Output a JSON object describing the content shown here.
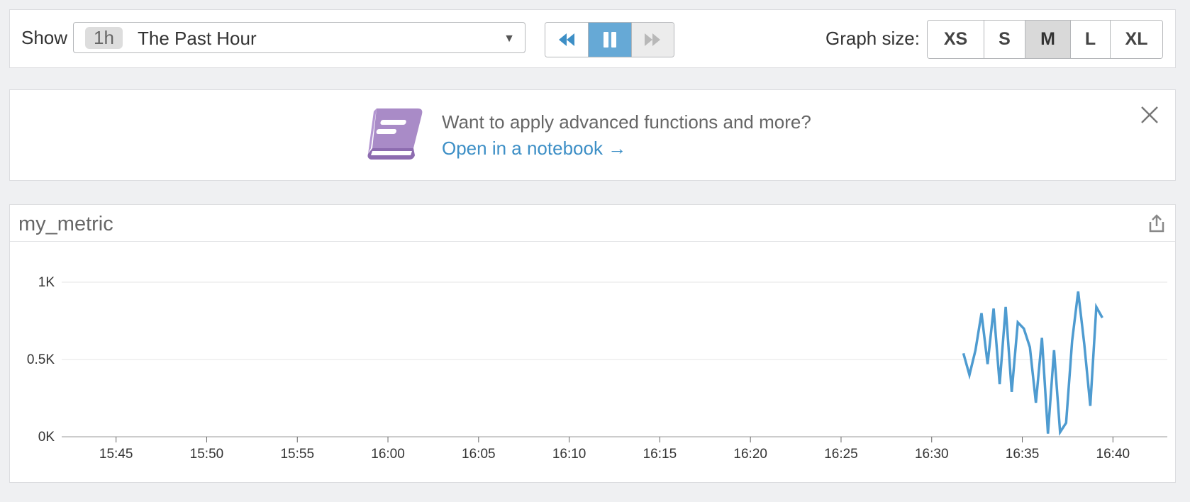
{
  "toolbar": {
    "show_label": "Show",
    "timeframe": {
      "badge": "1h",
      "label": "The Past Hour",
      "caret": "▼"
    },
    "playback": {
      "state": "paused",
      "rewind_icon": "double-chevron-left-icon",
      "pause_icon": "pause-icon",
      "forward_icon": "double-chevron-right-icon"
    },
    "graph_size": {
      "label": "Graph size:",
      "options": [
        "XS",
        "S",
        "M",
        "L",
        "XL"
      ],
      "selected": "M"
    }
  },
  "banner": {
    "text": "Want to apply advanced functions and more?",
    "link": "Open in a notebook →",
    "icon": "notebook-book-icon",
    "icon_color": "#a07fc0"
  },
  "graph": {
    "title": "my_metric",
    "share_icon": "share-export-icon",
    "line_color": "#4e9bd0",
    "chart_data": {
      "type": "line",
      "xlabel": "",
      "ylabel": "",
      "x_ticks": [
        "15:45",
        "15:50",
        "15:55",
        "16:00",
        "16:05",
        "16:10",
        "16:15",
        "16:20",
        "16:25",
        "16:30",
        "16:35",
        "16:40"
      ],
      "y_ticks": [
        "1K",
        "0.5K",
        "0K"
      ],
      "ylim": [
        0,
        1000
      ],
      "xlim": [
        "15:42",
        "16:43"
      ],
      "grid": true,
      "series": [
        {
          "x": [
            "16:31:45",
            "16:32:05",
            "16:32:25",
            "16:32:45",
            "16:33:05",
            "16:33:25",
            "16:33:45",
            "16:34:05",
            "16:34:25",
            "16:34:45",
            "16:35:05",
            "16:35:25",
            "16:35:45",
            "16:36:05",
            "16:36:25",
            "16:36:45",
            "16:37:05",
            "16:37:25",
            "16:37:45",
            "16:38:05",
            "16:38:25",
            "16:38:45",
            "16:39:05",
            "16:39:25"
          ],
          "y": [
            540,
            400,
            560,
            800,
            470,
            830,
            340,
            840,
            290,
            740,
            700,
            580,
            220,
            640,
            20,
            560,
            30,
            90,
            620,
            940,
            600,
            200,
            840,
            770
          ]
        }
      ]
    }
  }
}
